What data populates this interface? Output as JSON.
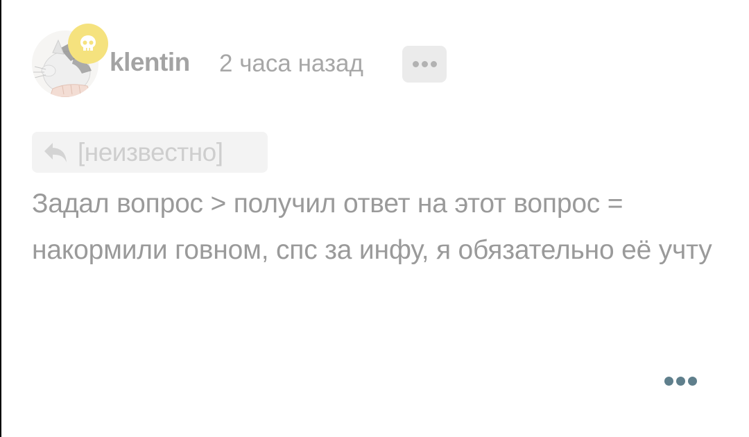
{
  "comment": {
    "author": {
      "username": "klentin",
      "avatar_icon": "cat-avatar-icon",
      "badge_icon": "skull-icon",
      "badge_color": "#f5e27e"
    },
    "timestamp": "2 часа назад",
    "header_menu_icon": "more-horizontal-icon",
    "reply_to": {
      "icon": "reply-arrow-icon",
      "label": "[неизвестно]"
    },
    "text": "Задал вопрос > получил ответ на этот вопрос = накормили говном, спс за инфу, я обязательно её учту",
    "footer_menu_icon": "more-horizontal-icon",
    "footer_menu_color": "#5f7f8c"
  }
}
